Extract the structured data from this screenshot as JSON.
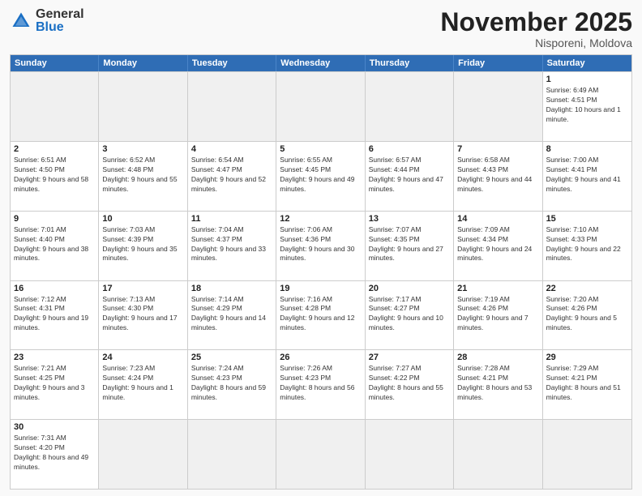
{
  "header": {
    "logo_general": "General",
    "logo_blue": "Blue",
    "month_title": "November 2025",
    "location": "Nisporeni, Moldova"
  },
  "days_of_week": [
    "Sunday",
    "Monday",
    "Tuesday",
    "Wednesday",
    "Thursday",
    "Friday",
    "Saturday"
  ],
  "weeks": [
    [
      {
        "day": "",
        "empty": true
      },
      {
        "day": "",
        "empty": true
      },
      {
        "day": "",
        "empty": true
      },
      {
        "day": "",
        "empty": true
      },
      {
        "day": "",
        "empty": true
      },
      {
        "day": "",
        "empty": true
      },
      {
        "day": "1",
        "sunrise": "6:49 AM",
        "sunset": "4:51 PM",
        "daylight": "10 hours and 1 minute."
      }
    ],
    [
      {
        "day": "2",
        "sunrise": "6:51 AM",
        "sunset": "4:50 PM",
        "daylight": "9 hours and 58 minutes."
      },
      {
        "day": "3",
        "sunrise": "6:52 AM",
        "sunset": "4:48 PM",
        "daylight": "9 hours and 55 minutes."
      },
      {
        "day": "4",
        "sunrise": "6:54 AM",
        "sunset": "4:47 PM",
        "daylight": "9 hours and 52 minutes."
      },
      {
        "day": "5",
        "sunrise": "6:55 AM",
        "sunset": "4:45 PM",
        "daylight": "9 hours and 49 minutes."
      },
      {
        "day": "6",
        "sunrise": "6:57 AM",
        "sunset": "4:44 PM",
        "daylight": "9 hours and 47 minutes."
      },
      {
        "day": "7",
        "sunrise": "6:58 AM",
        "sunset": "4:43 PM",
        "daylight": "9 hours and 44 minutes."
      },
      {
        "day": "8",
        "sunrise": "7:00 AM",
        "sunset": "4:41 PM",
        "daylight": "9 hours and 41 minutes."
      }
    ],
    [
      {
        "day": "9",
        "sunrise": "7:01 AM",
        "sunset": "4:40 PM",
        "daylight": "9 hours and 38 minutes."
      },
      {
        "day": "10",
        "sunrise": "7:03 AM",
        "sunset": "4:39 PM",
        "daylight": "9 hours and 35 minutes."
      },
      {
        "day": "11",
        "sunrise": "7:04 AM",
        "sunset": "4:37 PM",
        "daylight": "9 hours and 33 minutes."
      },
      {
        "day": "12",
        "sunrise": "7:06 AM",
        "sunset": "4:36 PM",
        "daylight": "9 hours and 30 minutes."
      },
      {
        "day": "13",
        "sunrise": "7:07 AM",
        "sunset": "4:35 PM",
        "daylight": "9 hours and 27 minutes."
      },
      {
        "day": "14",
        "sunrise": "7:09 AM",
        "sunset": "4:34 PM",
        "daylight": "9 hours and 24 minutes."
      },
      {
        "day": "15",
        "sunrise": "7:10 AM",
        "sunset": "4:33 PM",
        "daylight": "9 hours and 22 minutes."
      }
    ],
    [
      {
        "day": "16",
        "sunrise": "7:12 AM",
        "sunset": "4:31 PM",
        "daylight": "9 hours and 19 minutes."
      },
      {
        "day": "17",
        "sunrise": "7:13 AM",
        "sunset": "4:30 PM",
        "daylight": "9 hours and 17 minutes."
      },
      {
        "day": "18",
        "sunrise": "7:14 AM",
        "sunset": "4:29 PM",
        "daylight": "9 hours and 14 minutes."
      },
      {
        "day": "19",
        "sunrise": "7:16 AM",
        "sunset": "4:28 PM",
        "daylight": "9 hours and 12 minutes."
      },
      {
        "day": "20",
        "sunrise": "7:17 AM",
        "sunset": "4:27 PM",
        "daylight": "9 hours and 10 minutes."
      },
      {
        "day": "21",
        "sunrise": "7:19 AM",
        "sunset": "4:26 PM",
        "daylight": "9 hours and 7 minutes."
      },
      {
        "day": "22",
        "sunrise": "7:20 AM",
        "sunset": "4:26 PM",
        "daylight": "9 hours and 5 minutes."
      }
    ],
    [
      {
        "day": "23",
        "sunrise": "7:21 AM",
        "sunset": "4:25 PM",
        "daylight": "9 hours and 3 minutes."
      },
      {
        "day": "24",
        "sunrise": "7:23 AM",
        "sunset": "4:24 PM",
        "daylight": "9 hours and 1 minute."
      },
      {
        "day": "25",
        "sunrise": "7:24 AM",
        "sunset": "4:23 PM",
        "daylight": "8 hours and 59 minutes."
      },
      {
        "day": "26",
        "sunrise": "7:26 AM",
        "sunset": "4:23 PM",
        "daylight": "8 hours and 56 minutes."
      },
      {
        "day": "27",
        "sunrise": "7:27 AM",
        "sunset": "4:22 PM",
        "daylight": "8 hours and 55 minutes."
      },
      {
        "day": "28",
        "sunrise": "7:28 AM",
        "sunset": "4:21 PM",
        "daylight": "8 hours and 53 minutes."
      },
      {
        "day": "29",
        "sunrise": "7:29 AM",
        "sunset": "4:21 PM",
        "daylight": "8 hours and 51 minutes."
      }
    ],
    [
      {
        "day": "30",
        "sunrise": "7:31 AM",
        "sunset": "4:20 PM",
        "daylight": "8 hours and 49 minutes."
      },
      {
        "day": "",
        "empty": true
      },
      {
        "day": "",
        "empty": true
      },
      {
        "day": "",
        "empty": true
      },
      {
        "day": "",
        "empty": true
      },
      {
        "day": "",
        "empty": true
      },
      {
        "day": "",
        "empty": true
      }
    ]
  ]
}
